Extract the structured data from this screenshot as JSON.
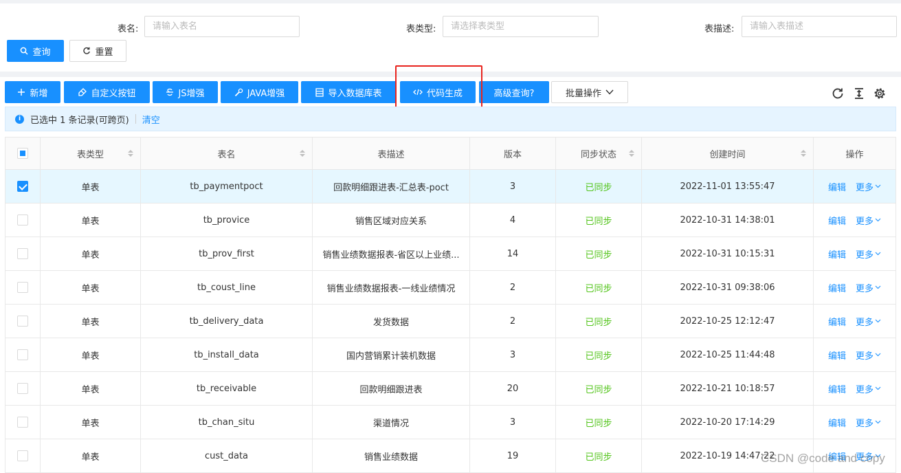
{
  "search": {
    "table_name_label": "表名:",
    "table_name_placeholder": "请输入表名",
    "table_type_label": "表类型:",
    "table_type_placeholder": "请选择表类型",
    "table_desc_label": "表描述:",
    "table_desc_placeholder": "请输入表描述",
    "query_button": "查询",
    "reset_button": "重置"
  },
  "toolbar": {
    "add": "新增",
    "custom_button": "自定义按钮",
    "js_enhance": "JS增强",
    "java_enhance": "JAVA增强",
    "import_db": "导入数据库表",
    "code_gen": "代码生成",
    "advanced_query": "高级查询?",
    "batch_ops": "批量操作",
    "accent_color": "#1890ff",
    "highlight_color": "#e8231d"
  },
  "alert": {
    "selected_text": "已选中 1 条记录(可跨页)",
    "clear": "清空"
  },
  "table": {
    "headers": {
      "type": "表类型",
      "name": "表名",
      "desc": "表描述",
      "version": "版本",
      "sync": "同步状态",
      "created": "创建时间",
      "actions": "操作"
    },
    "rows": [
      {
        "type": "单表",
        "name": "tb_paymentpoct",
        "desc": "回款明细跟进表-汇总表-poct",
        "version": "3",
        "sync": "已同步",
        "created": "2022-11-01 13:55:47",
        "edit": "编辑",
        "more": "更多",
        "selected": true
      },
      {
        "type": "单表",
        "name": "tb_provice",
        "desc": "销售区域对应关系",
        "version": "4",
        "sync": "已同步",
        "created": "2022-10-31 14:38:01",
        "edit": "编辑",
        "more": "更多",
        "selected": false
      },
      {
        "type": "单表",
        "name": "tb_prov_first",
        "desc": "销售业绩数据报表-省区以上业绩...",
        "version": "14",
        "sync": "已同步",
        "created": "2022-10-31 10:15:31",
        "edit": "编辑",
        "more": "更多",
        "selected": false
      },
      {
        "type": "单表",
        "name": "tb_coust_line",
        "desc": "销售业绩数据报表-一线业绩情况",
        "version": "2",
        "sync": "已同步",
        "created": "2022-10-31 09:38:06",
        "edit": "编辑",
        "more": "更多",
        "selected": false
      },
      {
        "type": "单表",
        "name": "tb_delivery_data",
        "desc": "发货数据",
        "version": "2",
        "sync": "已同步",
        "created": "2022-10-25 12:12:47",
        "edit": "编辑",
        "more": "更多",
        "selected": false
      },
      {
        "type": "单表",
        "name": "tb_install_data",
        "desc": "国内营销累计装机数据",
        "version": "3",
        "sync": "已同步",
        "created": "2022-10-25 11:44:48",
        "edit": "编辑",
        "more": "更多",
        "selected": false
      },
      {
        "type": "单表",
        "name": "tb_receivable",
        "desc": "回款明细跟进表",
        "version": "20",
        "sync": "已同步",
        "created": "2022-10-21 10:18:57",
        "edit": "编辑",
        "more": "更多",
        "selected": false
      },
      {
        "type": "单表",
        "name": "tb_chan_situ",
        "desc": "渠道情况",
        "version": "3",
        "sync": "已同步",
        "created": "2022-10-20 17:14:29",
        "edit": "编辑",
        "more": "更多",
        "selected": false
      },
      {
        "type": "单表",
        "name": "cust_data",
        "desc": "销售业绩数据",
        "version": "19",
        "sync": "已同步",
        "created": "2022-10-19 14:47:22",
        "edit": "编辑",
        "more": "更多",
        "selected": false
      }
    ]
  },
  "watermark": "CSDN @code and copy"
}
